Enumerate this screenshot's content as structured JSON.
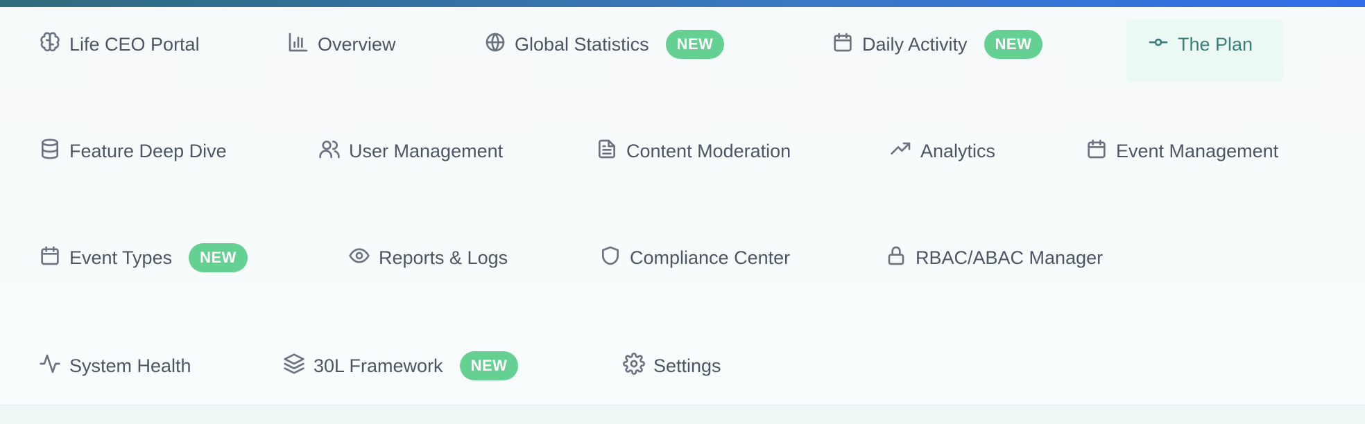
{
  "nav": {
    "items": [
      {
        "label": "Life CEO Portal",
        "icon": "brain-icon"
      },
      {
        "label": "Overview",
        "icon": "bar-chart-icon"
      },
      {
        "label": "Global Statistics",
        "icon": "globe-icon",
        "badge": "NEW"
      },
      {
        "label": "Daily Activity",
        "icon": "calendar-icon",
        "badge": "NEW"
      },
      {
        "label": "The Plan",
        "icon": "git-commit-icon",
        "active": true
      },
      {
        "label": "Feature Deep Dive",
        "icon": "database-icon"
      },
      {
        "label": "User Management",
        "icon": "users-icon"
      },
      {
        "label": "Content Moderation",
        "icon": "file-text-icon"
      },
      {
        "label": "Analytics",
        "icon": "trending-up-icon"
      },
      {
        "label": "Event Management",
        "icon": "calendar-icon"
      },
      {
        "label": "Event Types",
        "icon": "calendar-icon",
        "badge": "NEW"
      },
      {
        "label": "Reports & Logs",
        "icon": "eye-icon"
      },
      {
        "label": "Compliance Center",
        "icon": "shield-icon"
      },
      {
        "label": "RBAC/ABAC Manager",
        "icon": "lock-icon"
      },
      {
        "label": "System Health",
        "icon": "activity-icon"
      },
      {
        "label": "30L Framework",
        "icon": "layers-icon",
        "badge": "NEW"
      },
      {
        "label": "Settings",
        "icon": "settings-icon"
      }
    ]
  },
  "colors": {
    "accent_top_bar_start": "#2f6b7b",
    "accent_top_bar_end": "#2f6ee8",
    "badge_bg": "#64d092",
    "active_text": "#3b7f7a",
    "active_bg": "#ecf8f4",
    "text": "#4b5563",
    "icon": "#6b7280"
  }
}
